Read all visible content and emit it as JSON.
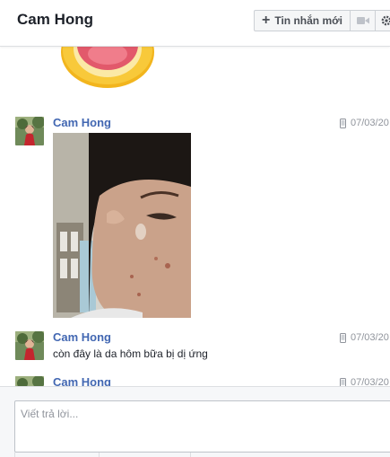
{
  "header": {
    "title": "Cam Hong",
    "new_message_label": "Tin nhắn mới",
    "plus_icon": "plus-icon",
    "video_icon": "video-camera-icon",
    "settings_icon": "gear-icon"
  },
  "messages": [
    {
      "sender": "Cam Hong",
      "time": "07/03/20",
      "type": "photo"
    },
    {
      "sender": "Cam Hong",
      "time": "07/03/20",
      "text": "còn đây là da hôm bữa bị dị ứng"
    },
    {
      "sender": "Cam Hong",
      "time": "07/03/20"
    }
  ],
  "composer": {
    "placeholder": "Viết trả lời..."
  },
  "colors": {
    "sender_link": "#4267b2",
    "timestamp": "#90949c",
    "border": "#dddfe2"
  }
}
